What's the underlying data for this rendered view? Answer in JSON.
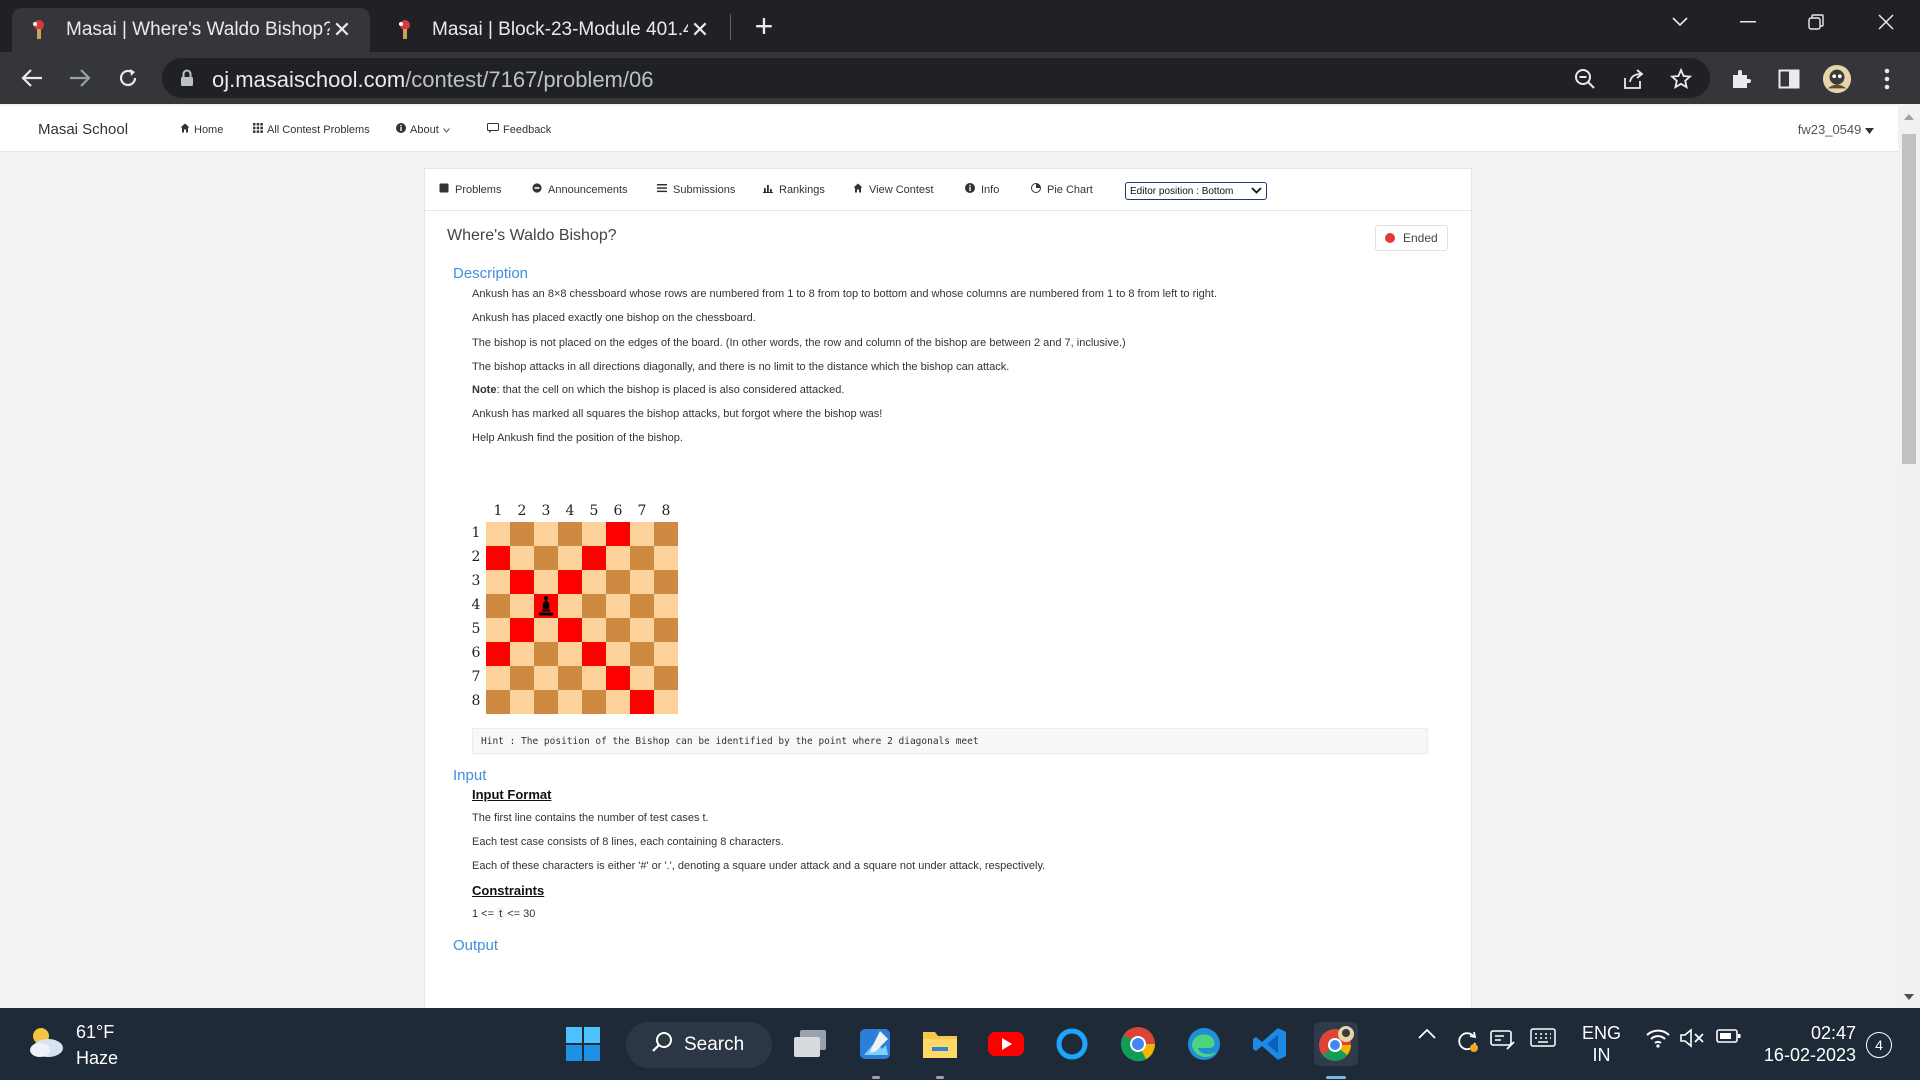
{
  "browser": {
    "tabs": [
      {
        "title": "Masai | Where's Waldo Bishop?",
        "active": true
      },
      {
        "title": "Masai | Block-23-Module 401.4.1",
        "active": false
      }
    ],
    "url_host": "oj.masaischool.com",
    "url_path": "/contest/7167/problem/06"
  },
  "sitenav": {
    "brand": "Masai School",
    "links": [
      "Home",
      "All Contest Problems",
      "About",
      "Feedback"
    ],
    "user": "fw23_0549"
  },
  "contest_tabs": [
    "Problems",
    "Announcements",
    "Submissions",
    "Rankings",
    "View Contest",
    "Info",
    "Pie Chart"
  ],
  "editor_position": "Editor position : Bottom",
  "problem": {
    "title": "Where's Waldo Bishop?",
    "status": "Ended",
    "description_heading": "Description",
    "description": [
      "Ankush has an 8×8 chessboard whose rows are numbered from 1 to 8 from top to bottom and whose columns are numbered from 1 to 8 from left to right.",
      "Ankush has placed exactly one bishop on the chessboard.",
      "The bishop is not placed on the edges of the board. (In other words, the row and column of the bishop are between 2 and 7, inclusive.)",
      "The bishop attacks in all directions diagonally, and there is no limit to the distance which the bishop can attack."
    ],
    "note_label": "Note",
    "note_text": ": that the cell on which the bishop is placed is also considered attacked.",
    "description_more": [
      "Ankush has marked all squares the bishop attacks, but forgot where the bishop was!",
      "Help Ankush find the position of the bishop."
    ],
    "board": {
      "col_labels": [
        "1",
        "2",
        "3",
        "4",
        "5",
        "6",
        "7",
        "8"
      ],
      "row_labels": [
        "1",
        "2",
        "3",
        "4",
        "5",
        "6",
        "7",
        "8"
      ],
      "bishop": [
        4,
        3
      ],
      "attacked": [
        [
          1,
          6
        ],
        [
          2,
          1
        ],
        [
          2,
          5
        ],
        [
          3,
          2
        ],
        [
          3,
          4
        ],
        [
          4,
          3
        ],
        [
          5,
          2
        ],
        [
          5,
          4
        ],
        [
          6,
          1
        ],
        [
          6,
          5
        ],
        [
          7,
          6
        ],
        [
          8,
          7
        ]
      ],
      "colors": {
        "light": "#fdd39b",
        "dark": "#cd8a40",
        "attacked": "#fe0000"
      }
    },
    "hint": "Hint : The position of the Bishop can be identified by the point where 2 diagonals meet",
    "input_heading": "Input",
    "input_format_heading": "Input Format",
    "input_format": [
      "The first line contains the number of test cases t.",
      "Each test case consists of 8 lines, each containing 8 characters.",
      "Each of these characters is either '#' or '.', denoting a square under attack and a square not under attack, respectively."
    ],
    "constraints_heading": "Constraints",
    "constraints_prefix": "1 <= ",
    "constraints_var": "t",
    "constraints_suffix": " <= 30",
    "output_heading": "Output"
  },
  "taskbar": {
    "temperature": "61°F",
    "weather": "Haze",
    "search": "Search",
    "lang_top": "ENG",
    "lang_bottom": "IN",
    "time": "02:47",
    "date": "16-02-2023",
    "notifications": "4"
  }
}
